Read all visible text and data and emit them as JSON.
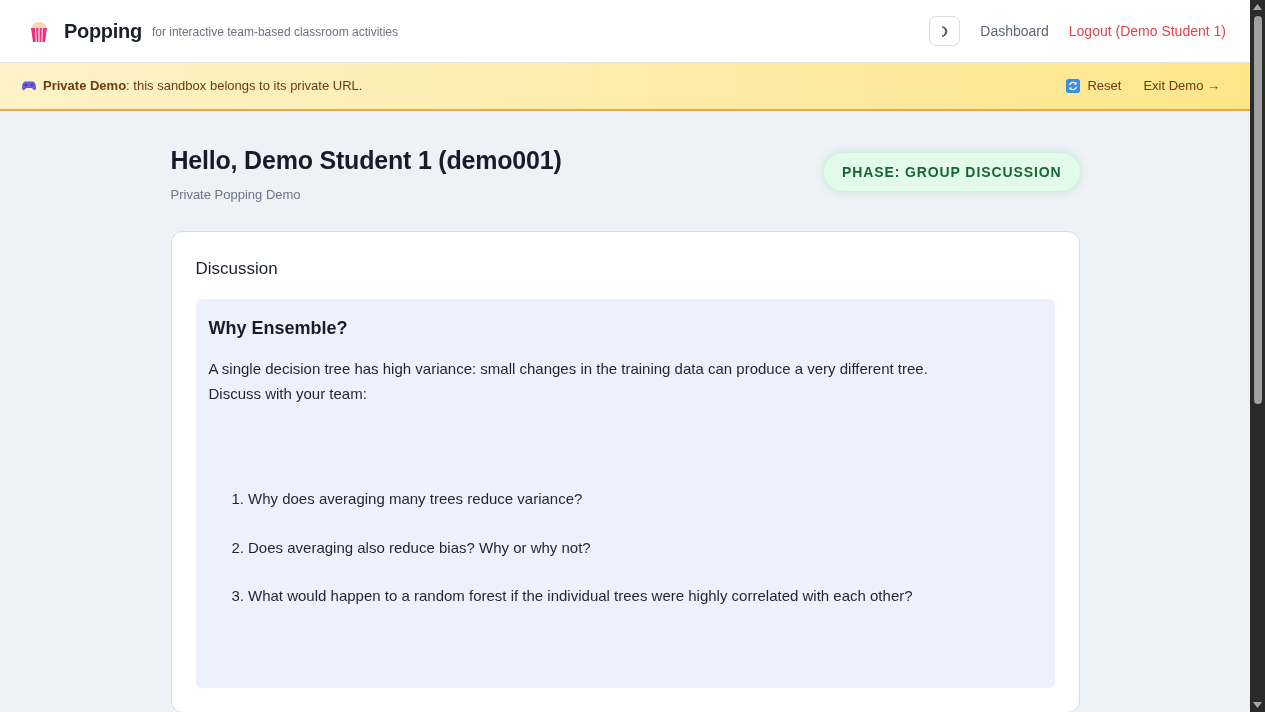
{
  "header": {
    "brand": "Popping",
    "tagline": "for interactive team-based classroom activities",
    "nav": [
      {
        "label": "Dashboard",
        "kind": "link"
      },
      {
        "label": "Logout (Demo Student 1)",
        "kind": "logout"
      }
    ]
  },
  "demo_banner": {
    "message": "**Private Demo**: this sandbox belongs to its private URL.",
    "actions": [
      {
        "label": "Reset",
        "kind": "reset"
      },
      {
        "label": "Exit Demo →",
        "kind": "exit"
      }
    ]
  },
  "greeting": {
    "title": "Hello, Demo Student 1 (demo001)",
    "subtitle": "Private Popping Demo",
    "phase_badge": "PHASE: GROUP DISCUSSION"
  },
  "discussion_card": {
    "heading": "Discussion",
    "prompt": {
      "title": "Why Ensemble?",
      "intro": "A single decision tree has high variance: small changes in the training data can produce a very different tree.\nDiscuss with your team:",
      "questions": [
        {
          "number": "1.",
          "text": "Why does averaging many trees reduce variance?"
        },
        {
          "number": "2.",
          "text": "Does averaging also reduce bias? Why or why not?"
        },
        {
          "number": "3.",
          "text": "What would happen to a random forest if the individual trees were highly correlated with each other?"
        }
      ]
    }
  }
}
